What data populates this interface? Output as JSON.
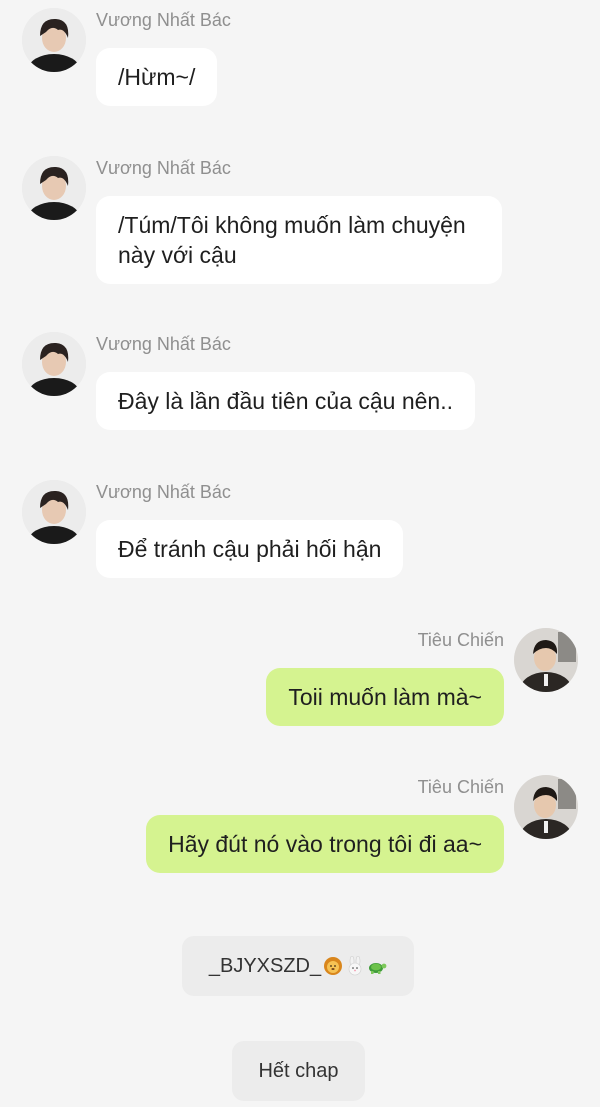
{
  "messages": [
    {
      "side": "left",
      "sender": "Vương Nhất Bác",
      "text": "/Hừm~/"
    },
    {
      "side": "left",
      "sender": "Vương Nhất Bác",
      "text": "/Túm/Tôi không muốn làm chuyện này với cậu"
    },
    {
      "side": "left",
      "sender": "Vương Nhất Bác",
      "text": "Đây là lần đầu tiên của cậu nên.."
    },
    {
      "side": "left",
      "sender": "Vương Nhất Bác",
      "text": "Để tránh cậu phải hối hận"
    },
    {
      "side": "right",
      "sender": "Tiêu Chiến",
      "text": "Toii muốn làm mà~"
    },
    {
      "side": "right",
      "sender": "Tiêu Chiến",
      "text": "Hãy đút nó vào trong tôi đi aa~"
    }
  ],
  "footer": {
    "author_tag": "_BJYXSZD_",
    "author_emojis": [
      "lion-emoji",
      "rabbit-emoji",
      "turtle-emoji"
    ],
    "end_label": "Hết chap"
  },
  "colors": {
    "background": "#f5f5f5",
    "left_bubble": "#ffffff",
    "right_bubble": "#d5f390",
    "name": "#8f8f8f"
  }
}
